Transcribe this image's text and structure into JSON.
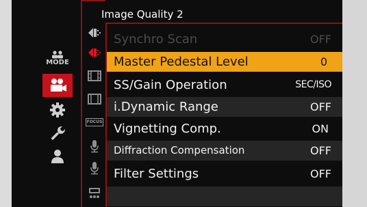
{
  "menu": {
    "title": "Image Quality 2",
    "items": [
      {
        "label": "Synchro Scan",
        "value": "OFF",
        "state": "disabled"
      },
      {
        "label": "Master Pedestal Level",
        "value": "0",
        "state": "selected"
      },
      {
        "label": "SS/Gain Operation",
        "value": "SEC/ISO",
        "state": "normal"
      },
      {
        "label": "i.Dynamic Range",
        "value": "OFF",
        "state": "normal"
      },
      {
        "label": "Vignetting Comp.",
        "value": "ON",
        "state": "normal"
      },
      {
        "label": "Diffraction Compensation",
        "value": "OFF",
        "state": "normal"
      },
      {
        "label": "Filter Settings",
        "value": "OFF",
        "state": "normal"
      }
    ]
  },
  "categories": {
    "mode_label": "MODE",
    "items": [
      "mode-icon",
      "video-camera-icon",
      "gear-icon",
      "wrench-icon",
      "person-icon"
    ],
    "active": "video-camera-icon"
  },
  "subtabs": {
    "focus_label": "FOCUS",
    "items": [
      "image-quality-icon",
      "image-quality-active-icon",
      "film-strip-icon",
      "film-frame-icon",
      "focus-icon",
      "microphone-icon",
      "microphone-2-icon",
      "tc-icon"
    ]
  },
  "colors": {
    "selection": "#f0a316",
    "accent_red": "#c5121c",
    "background": "#0d0d0d",
    "disabled_text": "#4b4b4b"
  }
}
